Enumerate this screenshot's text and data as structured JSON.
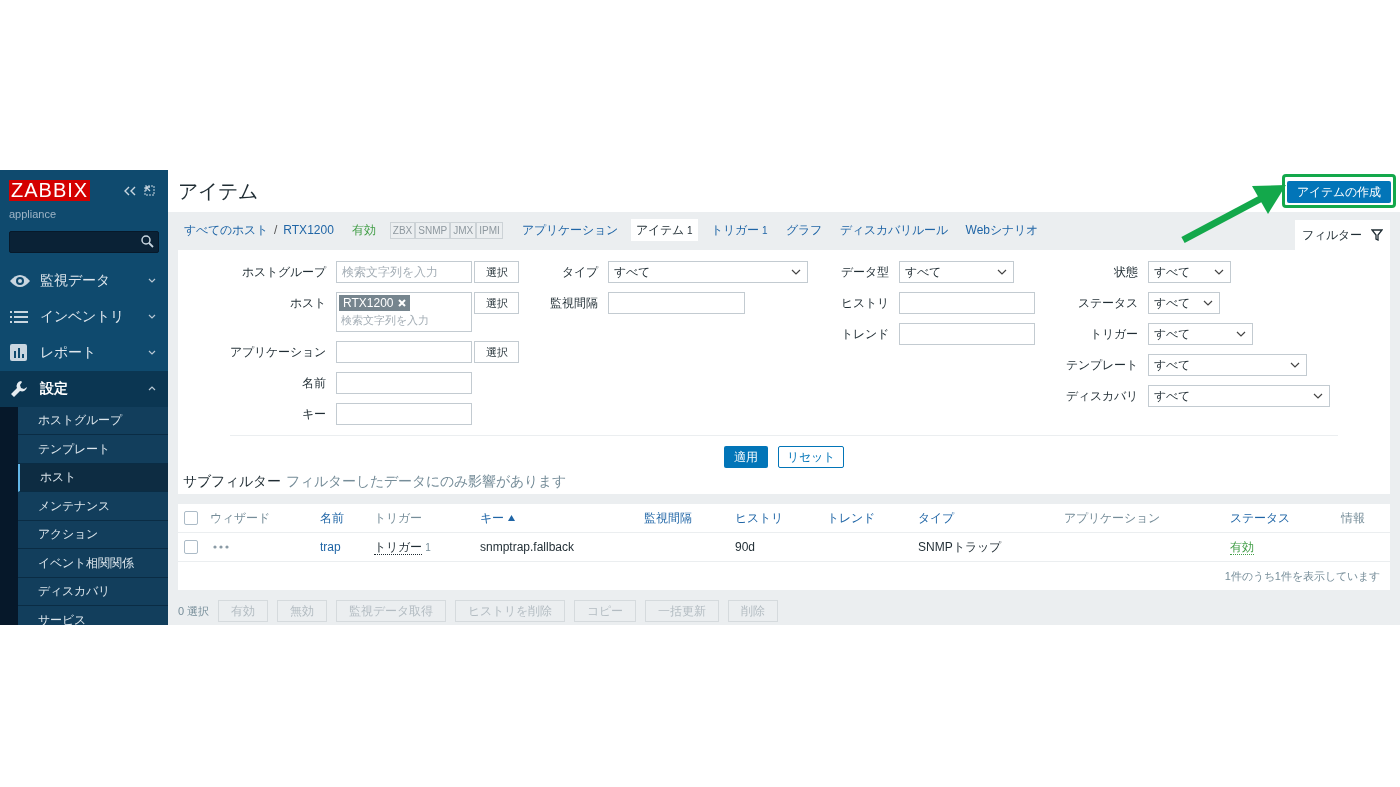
{
  "sidebar": {
    "logo": "ZABBIX",
    "server_name": "appliance",
    "menu": [
      {
        "label": "監視データ",
        "expanded": false
      },
      {
        "label": "インベントリ",
        "expanded": false
      },
      {
        "label": "レポート",
        "expanded": false
      },
      {
        "label": "設定",
        "expanded": true,
        "children": [
          {
            "label": "ホストグループ",
            "selected": false
          },
          {
            "label": "テンプレート",
            "selected": false
          },
          {
            "label": "ホスト",
            "selected": true
          },
          {
            "label": "メンテナンス",
            "selected": false
          },
          {
            "label": "アクション",
            "selected": false
          },
          {
            "label": "イベント相関関係",
            "selected": false
          },
          {
            "label": "ディスカバリ",
            "selected": false
          },
          {
            "label": "サービス",
            "selected": false
          }
        ]
      }
    ]
  },
  "header": {
    "title": "アイテム",
    "create_button": "アイテムの作成"
  },
  "nav": {
    "breadcrumbs": [
      "すべてのホスト",
      "RTX1200"
    ],
    "breadcrumb_separator": "/",
    "status": "有効",
    "availability": [
      {
        "label": "ZBX",
        "available": false
      },
      {
        "label": "SNMP",
        "available": false
      },
      {
        "label": "JMX",
        "available": false
      },
      {
        "label": "IPMI",
        "available": false
      }
    ],
    "tabs": [
      {
        "label": "アプリケーション",
        "selected": false
      },
      {
        "label": "アイテム",
        "count": "1",
        "selected": true
      },
      {
        "label": "トリガー",
        "count": "1",
        "selected": false
      },
      {
        "label": "グラフ",
        "selected": false
      },
      {
        "label": "ディスカバリルール",
        "selected": false
      },
      {
        "label": "Webシナリオ",
        "selected": false
      }
    ],
    "filter_tab": "フィルター"
  },
  "filter": {
    "columns": [
      [
        {
          "label": "ホストグループ",
          "kind": "text",
          "placeholder": "検索文字列を入力",
          "select_button": "選択"
        },
        {
          "label": "ホスト",
          "kind": "multiselect",
          "tags": [
            "RTX1200"
          ],
          "placeholder": "検索文字列を入力",
          "select_button": "選択"
        },
        {
          "label": "アプリケーション",
          "kind": "text",
          "select_button": "選択"
        },
        {
          "label": "名前",
          "kind": "text"
        },
        {
          "label": "キー",
          "kind": "text"
        }
      ],
      [
        {
          "label": "タイプ",
          "kind": "select",
          "value": "すべて"
        },
        {
          "label": "監視間隔",
          "kind": "text"
        }
      ],
      [
        {
          "label": "データ型",
          "kind": "select",
          "value": "すべて"
        },
        {
          "label": "ヒストリ",
          "kind": "text"
        },
        {
          "label": "トレンド",
          "kind": "text"
        }
      ],
      [
        {
          "label": "状態",
          "kind": "select",
          "value": "すべて"
        },
        {
          "label": "ステータス",
          "kind": "select",
          "value": "すべて"
        },
        {
          "label": "トリガー",
          "kind": "select",
          "value": "すべて"
        },
        {
          "label": "テンプレート",
          "kind": "select",
          "value": "すべて"
        },
        {
          "label": "ディスカバリ",
          "kind": "select",
          "value": "すべて"
        }
      ]
    ],
    "apply_button": "適用",
    "reset_button": "リセット",
    "subfilter_title": "サブフィルター",
    "subfilter_note": "フィルターしたデータにのみ影響があります"
  },
  "table": {
    "select_all_checked": false,
    "columns": [
      {
        "label": "ウィザード",
        "sortable": false
      },
      {
        "label": "名前",
        "sortable": true
      },
      {
        "label": "トリガー",
        "sortable": false
      },
      {
        "label": "キー",
        "sortable": true,
        "sorted": true
      },
      {
        "label": "監視間隔",
        "sortable": true
      },
      {
        "label": "ヒストリ",
        "sortable": true
      },
      {
        "label": "トレンド",
        "sortable": true
      },
      {
        "label": "タイプ",
        "sortable": true
      },
      {
        "label": "アプリケーション",
        "sortable": false
      },
      {
        "label": "ステータス",
        "sortable": true
      },
      {
        "label": "情報",
        "sortable": false
      }
    ],
    "rows": [
      {
        "checked": false,
        "name": "trap",
        "triggers": {
          "label": "トリガー",
          "count": "1"
        },
        "key": "snmptrap.fallback",
        "history": "90d",
        "type": "SNMPトラップ",
        "status": {
          "label": "有効",
          "enabled": true
        }
      }
    ],
    "footer": "1件のうち1件を表示しています"
  },
  "actions": {
    "selected_count": "0 選択",
    "buttons": [
      {
        "label": "有効",
        "disabled": true
      },
      {
        "label": "無効",
        "disabled": true
      },
      {
        "label": "監視データ取得",
        "disabled": true
      },
      {
        "label": "ヒストリを削除",
        "disabled": true
      },
      {
        "label": "コピー",
        "disabled": true
      },
      {
        "label": "一括更新",
        "disabled": true
      },
      {
        "label": "削除",
        "disabled": true
      }
    ]
  }
}
